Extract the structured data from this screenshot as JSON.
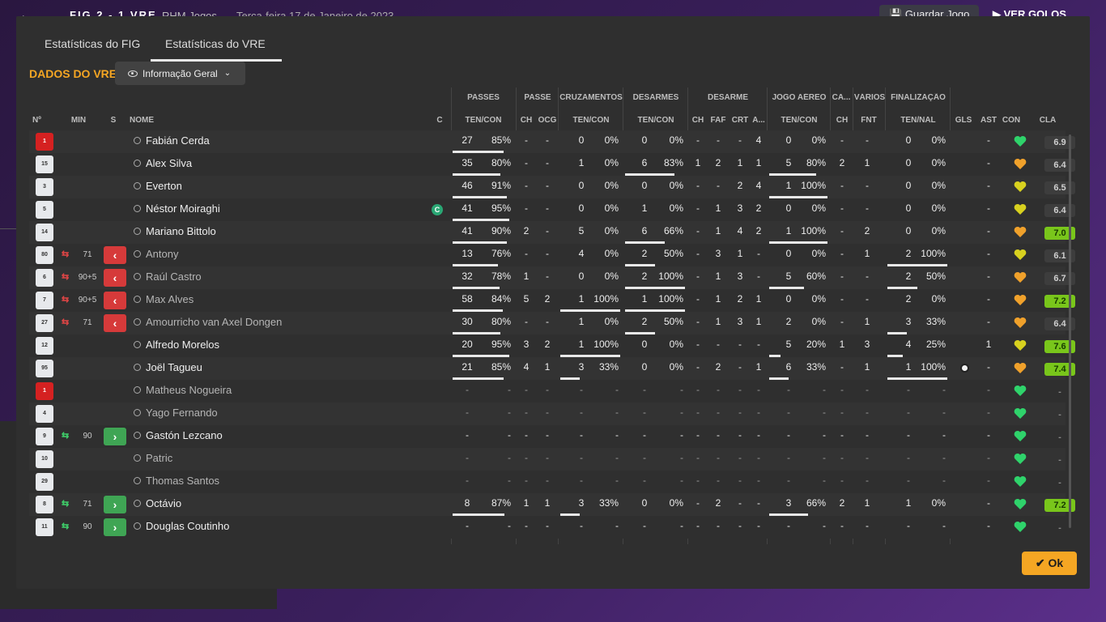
{
  "background": {
    "back_icon": "arrow-left-icon",
    "score": "FIG  2 - 1  VRE",
    "channel": "RHM Jogos",
    "date": "Terça-feira 17 de Janeiro de 2023",
    "save_label": "Guardar Jogo",
    "watch_label": "VER GOLOS"
  },
  "tabs": [
    "Estatísticas do FIG",
    "Estatísticas do VRE"
  ],
  "active_tab": 1,
  "section_title": "DADOS DO VRE",
  "dropdown": {
    "icon": "eye-icon",
    "label": "Informação Geral"
  },
  "group_headers": [
    "PASSES",
    "PASSE",
    "CRUZAMENTOS",
    "DESARMES",
    "DESARME",
    "JOGO AÉREO",
    "CA...",
    "VÁRIOS",
    "FINALIZAÇÃO"
  ],
  "column_headers": {
    "num": "Nº",
    "min": "MIN",
    "s": "S",
    "nome": "NOME",
    "c": "C",
    "passes": "TEN/CON",
    "passe_ch": "CH",
    "passe_ocg": "OCG",
    "cruz": "TEN/CON",
    "des": "TEN/CON",
    "desarme_ch": "CH",
    "desarme_faf": "FAF",
    "desarme_crt": "CRT",
    "desarme_a": "A...",
    "aereo": "TEN/CON",
    "ca_ch": "CH",
    "varios_fnt": "FNT",
    "final": "TEN/NAL",
    "gls": "GLS",
    "ast": "AST",
    "con": "CON",
    "cla": "CLA"
  },
  "colors": {
    "accent": "#f5a623",
    "out": "#d63a3a",
    "in": "#3fa554",
    "good_rating": "#79c61b"
  },
  "rows": [
    {
      "num": "1",
      "gk": true,
      "min": "",
      "sub": "",
      "name": "Fabián Cerda",
      "captain": false,
      "p": [
        "27",
        "85%"
      ],
      "pb": 0.85,
      "pch": "-",
      "pocg": "-",
      "cr": [
        "0",
        "0%"
      ],
      "crb": 0,
      "de": [
        "0",
        "0%"
      ],
      "deb": 0,
      "dch": "-",
      "faf": "-",
      "crt": "-",
      "da": "4",
      "ae": [
        "0",
        "0%"
      ],
      "aeb": 0,
      "cach": "-",
      "fnt": "-",
      "fi": [
        "0",
        "0%"
      ],
      "fib": 0,
      "gls": "",
      "ball": false,
      "ast": "-",
      "con": "green",
      "cla": "6.9",
      "good": false
    },
    {
      "num": "15",
      "gk": false,
      "min": "",
      "sub": "",
      "name": "Alex Silva",
      "captain": false,
      "p": [
        "35",
        "80%"
      ],
      "pb": 0.8,
      "pch": "-",
      "pocg": "-",
      "cr": [
        "1",
        "0%"
      ],
      "crb": 0,
      "de": [
        "6",
        "83%"
      ],
      "deb": 0.83,
      "dch": "1",
      "faf": "2",
      "crt": "1",
      "da": "1",
      "ae": [
        "5",
        "80%"
      ],
      "aeb": 0.8,
      "cach": "2",
      "fnt": "1",
      "fi": [
        "0",
        "0%"
      ],
      "fib": 0,
      "gls": "",
      "ball": false,
      "ast": "-",
      "con": "orange",
      "cla": "6.4",
      "good": false
    },
    {
      "num": "3",
      "gk": false,
      "min": "",
      "sub": "",
      "name": "Everton",
      "captain": false,
      "p": [
        "46",
        "91%"
      ],
      "pb": 0.91,
      "pch": "-",
      "pocg": "-",
      "cr": [
        "0",
        "0%"
      ],
      "crb": 0,
      "de": [
        "0",
        "0%"
      ],
      "deb": 0,
      "dch": "-",
      "faf": "-",
      "crt": "2",
      "da": "4",
      "ae": [
        "1",
        "100%"
      ],
      "aeb": 1,
      "cach": "-",
      "fnt": "-",
      "fi": [
        "0",
        "0%"
      ],
      "fib": 0,
      "gls": "",
      "ball": false,
      "ast": "-",
      "con": "yellow",
      "cla": "6.5",
      "good": false
    },
    {
      "num": "5",
      "gk": false,
      "min": "",
      "sub": "",
      "name": "Néstor Moiraghi",
      "captain": true,
      "p": [
        "41",
        "95%"
      ],
      "pb": 0.95,
      "pch": "-",
      "pocg": "-",
      "cr": [
        "0",
        "0%"
      ],
      "crb": 0,
      "de": [
        "1",
        "0%"
      ],
      "deb": 0,
      "dch": "-",
      "faf": "1",
      "crt": "3",
      "da": "2",
      "ae": [
        "0",
        "0%"
      ],
      "aeb": 0,
      "cach": "-",
      "fnt": "-",
      "fi": [
        "0",
        "0%"
      ],
      "fib": 0,
      "gls": "",
      "ball": false,
      "ast": "-",
      "con": "yellow",
      "cla": "6.4",
      "good": false
    },
    {
      "num": "14",
      "gk": false,
      "min": "",
      "sub": "",
      "name": "Mariano Bittolo",
      "captain": false,
      "p": [
        "41",
        "90%"
      ],
      "pb": 0.9,
      "pch": "2",
      "pocg": "-",
      "cr": [
        "5",
        "0%"
      ],
      "crb": 0,
      "de": [
        "6",
        "66%"
      ],
      "deb": 0.66,
      "dch": "-",
      "faf": "1",
      "crt": "4",
      "da": "2",
      "ae": [
        "1",
        "100%"
      ],
      "aeb": 1,
      "cach": "-",
      "fnt": "2",
      "fi": [
        "0",
        "0%"
      ],
      "fib": 0,
      "gls": "",
      "ball": false,
      "ast": "-",
      "con": "orange",
      "cla": "7.0",
      "good": true
    },
    {
      "num": "80",
      "gk": false,
      "min": "71",
      "sub": "out",
      "name": "Antony",
      "captain": false,
      "p": [
        "13",
        "76%"
      ],
      "pb": 0.76,
      "pch": "-",
      "pocg": "-",
      "cr": [
        "4",
        "0%"
      ],
      "crb": 0,
      "de": [
        "2",
        "50%"
      ],
      "deb": 0.5,
      "dch": "-",
      "faf": "3",
      "crt": "1",
      "da": "-",
      "ae": [
        "0",
        "0%"
      ],
      "aeb": 0,
      "cach": "-",
      "fnt": "1",
      "fi": [
        "2",
        "100%"
      ],
      "fib": 1,
      "gls": "",
      "ball": false,
      "ast": "-",
      "con": "yellow",
      "cla": "6.1",
      "good": false
    },
    {
      "num": "6",
      "gk": false,
      "min": "90+5",
      "sub": "out",
      "name": "Raúl Castro",
      "captain": false,
      "p": [
        "32",
        "78%"
      ],
      "pb": 0.78,
      "pch": "1",
      "pocg": "-",
      "cr": [
        "0",
        "0%"
      ],
      "crb": 0,
      "de": [
        "2",
        "100%"
      ],
      "deb": 1,
      "dch": "-",
      "faf": "1",
      "crt": "3",
      "da": "-",
      "ae": [
        "5",
        "60%"
      ],
      "aeb": 0.6,
      "cach": "-",
      "fnt": "-",
      "fi": [
        "2",
        "50%"
      ],
      "fib": 0.5,
      "gls": "",
      "ball": false,
      "ast": "-",
      "con": "orange",
      "cla": "6.7",
      "good": false
    },
    {
      "num": "7",
      "gk": false,
      "min": "90+5",
      "sub": "out",
      "name": "Max Alves",
      "captain": false,
      "p": [
        "58",
        "84%"
      ],
      "pb": 0.84,
      "pch": "5",
      "pocg": "2",
      "cr": [
        "1",
        "100%"
      ],
      "crb": 1,
      "de": [
        "1",
        "100%"
      ],
      "deb": 1,
      "dch": "-",
      "faf": "1",
      "crt": "2",
      "da": "1",
      "ae": [
        "0",
        "0%"
      ],
      "aeb": 0,
      "cach": "-",
      "fnt": "-",
      "fi": [
        "2",
        "0%"
      ],
      "fib": 0,
      "gls": "",
      "ball": false,
      "ast": "-",
      "con": "orange",
      "cla": "7.2",
      "good": true
    },
    {
      "num": "27",
      "gk": false,
      "min": "71",
      "sub": "out",
      "name": "Amourricho van Axel Dongen",
      "captain": false,
      "p": [
        "30",
        "80%"
      ],
      "pb": 0.8,
      "pch": "-",
      "pocg": "-",
      "cr": [
        "1",
        "0%"
      ],
      "crb": 0,
      "de": [
        "2",
        "50%"
      ],
      "deb": 0.5,
      "dch": "-",
      "faf": "1",
      "crt": "3",
      "da": "1",
      "ae": [
        "2",
        "0%"
      ],
      "aeb": 0,
      "cach": "-",
      "fnt": "1",
      "fi": [
        "3",
        "33%"
      ],
      "fib": 0.33,
      "gls": "",
      "ball": false,
      "ast": "-",
      "con": "orange",
      "cla": "6.4",
      "good": false
    },
    {
      "num": "12",
      "gk": false,
      "min": "",
      "sub": "",
      "name": "Alfredo Morelos",
      "captain": false,
      "p": [
        "20",
        "95%"
      ],
      "pb": 0.95,
      "pch": "3",
      "pocg": "2",
      "cr": [
        "1",
        "100%"
      ],
      "crb": 1,
      "de": [
        "0",
        "0%"
      ],
      "deb": 0,
      "dch": "-",
      "faf": "-",
      "crt": "-",
      "da": "-",
      "ae": [
        "5",
        "20%"
      ],
      "aeb": 0.2,
      "cach": "1",
      "fnt": "3",
      "fi": [
        "4",
        "25%"
      ],
      "fib": 0.25,
      "gls": "",
      "ball": false,
      "ast": "1",
      "con": "yellow",
      "cla": "7.6",
      "good": true
    },
    {
      "num": "95",
      "gk": false,
      "min": "",
      "sub": "",
      "name": "Joël Tagueu",
      "captain": false,
      "p": [
        "21",
        "85%"
      ],
      "pb": 0.85,
      "pch": "4",
      "pocg": "1",
      "cr": [
        "3",
        "33%"
      ],
      "crb": 0.33,
      "de": [
        "0",
        "0%"
      ],
      "deb": 0,
      "dch": "-",
      "faf": "2",
      "crt": "-",
      "da": "1",
      "ae": [
        "6",
        "33%"
      ],
      "aeb": 0.33,
      "cach": "-",
      "fnt": "1",
      "fi": [
        "1",
        "100%"
      ],
      "fib": 1,
      "gls": "",
      "ball": true,
      "ast": "-",
      "con": "orange",
      "cla": "7.4",
      "good": true
    },
    {
      "num": "1",
      "gk": true,
      "min": "",
      "sub": "",
      "name": "Matheus Nogueira",
      "captain": false,
      "p": [
        "-",
        "-"
      ],
      "pb": 0,
      "pch": "-",
      "pocg": "-",
      "cr": [
        "-",
        "-"
      ],
      "crb": 0,
      "de": [
        "-",
        "-"
      ],
      "deb": 0,
      "dch": "-",
      "faf": "-",
      "crt": "-",
      "da": "-",
      "ae": [
        "-",
        "-"
      ],
      "aeb": 0,
      "cach": "-",
      "fnt": "-",
      "fi": [
        "-",
        "-"
      ],
      "fib": 0,
      "gls": "",
      "ball": false,
      "ast": "-",
      "con": "green",
      "cla": "-",
      "good": false,
      "bench": true
    },
    {
      "num": "4",
      "gk": false,
      "min": "",
      "sub": "",
      "name": "Yago Fernando",
      "captain": false,
      "p": [
        "-",
        "-"
      ],
      "pb": 0,
      "pch": "-",
      "pocg": "-",
      "cr": [
        "-",
        "-"
      ],
      "crb": 0,
      "de": [
        "-",
        "-"
      ],
      "deb": 0,
      "dch": "-",
      "faf": "-",
      "crt": "-",
      "da": "-",
      "ae": [
        "-",
        "-"
      ],
      "aeb": 0,
      "cach": "-",
      "fnt": "-",
      "fi": [
        "-",
        "-"
      ],
      "fib": 0,
      "gls": "",
      "ball": false,
      "ast": "-",
      "con": "green",
      "cla": "-",
      "good": false,
      "bench": true
    },
    {
      "num": "9",
      "gk": false,
      "min": "90",
      "sub": "in",
      "name": "Gastón Lezcano",
      "captain": false,
      "p": [
        "-",
        "-"
      ],
      "pb": 0,
      "pch": "-",
      "pocg": "-",
      "cr": [
        "-",
        "-"
      ],
      "crb": 0,
      "de": [
        "-",
        "-"
      ],
      "deb": 0,
      "dch": "-",
      "faf": "-",
      "crt": "-",
      "da": "-",
      "ae": [
        "-",
        "-"
      ],
      "aeb": 0,
      "cach": "-",
      "fnt": "-",
      "fi": [
        "-",
        "-"
      ],
      "fib": 0,
      "gls": "",
      "ball": false,
      "ast": "-",
      "con": "green",
      "cla": "-",
      "good": false
    },
    {
      "num": "10",
      "gk": false,
      "min": "",
      "sub": "",
      "name": "Patric",
      "captain": false,
      "p": [
        "-",
        "-"
      ],
      "pb": 0,
      "pch": "-",
      "pocg": "-",
      "cr": [
        "-",
        "-"
      ],
      "crb": 0,
      "de": [
        "-",
        "-"
      ],
      "deb": 0,
      "dch": "-",
      "faf": "-",
      "crt": "-",
      "da": "-",
      "ae": [
        "-",
        "-"
      ],
      "aeb": 0,
      "cach": "-",
      "fnt": "-",
      "fi": [
        "-",
        "-"
      ],
      "fib": 0,
      "gls": "",
      "ball": false,
      "ast": "-",
      "con": "green",
      "cla": "-",
      "good": false,
      "bench": true
    },
    {
      "num": "29",
      "gk": false,
      "min": "",
      "sub": "",
      "name": "Thomas Santos",
      "captain": false,
      "p": [
        "-",
        "-"
      ],
      "pb": 0,
      "pch": "-",
      "pocg": "-",
      "cr": [
        "-",
        "-"
      ],
      "crb": 0,
      "de": [
        "-",
        "-"
      ],
      "deb": 0,
      "dch": "-",
      "faf": "-",
      "crt": "-",
      "da": "-",
      "ae": [
        "-",
        "-"
      ],
      "aeb": 0,
      "cach": "-",
      "fnt": "-",
      "fi": [
        "-",
        "-"
      ],
      "fib": 0,
      "gls": "",
      "ball": false,
      "ast": "-",
      "con": "green",
      "cla": "-",
      "good": false,
      "bench": true
    },
    {
      "num": "8",
      "gk": false,
      "min": "71",
      "sub": "in",
      "name": "Octávio",
      "captain": false,
      "p": [
        "8",
        "87%"
      ],
      "pb": 0.87,
      "pch": "1",
      "pocg": "1",
      "cr": [
        "3",
        "33%"
      ],
      "crb": 0.33,
      "de": [
        "0",
        "0%"
      ],
      "deb": 0,
      "dch": "-",
      "faf": "2",
      "crt": "-",
      "da": "-",
      "ae": [
        "3",
        "66%"
      ],
      "aeb": 0.66,
      "cach": "2",
      "fnt": "1",
      "fi": [
        "1",
        "0%"
      ],
      "fib": 0,
      "gls": "",
      "ball": false,
      "ast": "-",
      "con": "green",
      "cla": "7.2",
      "good": true
    },
    {
      "num": "11",
      "gk": false,
      "min": "90",
      "sub": "in",
      "name": "Douglas Coutinho",
      "captain": false,
      "p": [
        "-",
        "-"
      ],
      "pb": 0,
      "pch": "-",
      "pocg": "-",
      "cr": [
        "-",
        "-"
      ],
      "crb": 0,
      "de": [
        "-",
        "-"
      ],
      "deb": 0,
      "dch": "-",
      "faf": "-",
      "crt": "-",
      "da": "-",
      "ae": [
        "-",
        "-"
      ],
      "aeb": 0,
      "cach": "-",
      "fnt": "-",
      "fi": [
        "-",
        "-"
      ],
      "fib": 0,
      "gls": "",
      "ball": false,
      "ast": "-",
      "con": "green",
      "cla": "-",
      "good": false
    }
  ],
  "ok_label": "Ok"
}
